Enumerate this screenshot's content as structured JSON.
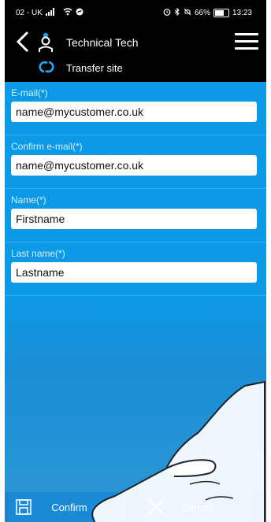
{
  "status_bar": {
    "carrier": "02 - UK",
    "battery": "66%",
    "time": "13:23"
  },
  "header": {
    "technician_name": "Technical Tech",
    "site_action": "Transfer site"
  },
  "form": {
    "email": {
      "label": "E-mail(*)",
      "value": "name@mycustomer.co.uk"
    },
    "confirm_email": {
      "label": "Confirm e-mail(*)",
      "value": "name@mycustomer.co.uk"
    },
    "name": {
      "label": "Name(*)",
      "value": "Firstname"
    },
    "last_name": {
      "label": "Last name(*)",
      "value": "Lastname"
    }
  },
  "actions": {
    "confirm_label": "Confirm",
    "cancel_label": "Cancel"
  },
  "icons": {
    "back": "chevron-left-icon",
    "user": "user-icon",
    "menu": "hamburger-menu-icon",
    "transfer": "cloud-link-icon",
    "save": "save-icon",
    "close": "close-icon"
  }
}
